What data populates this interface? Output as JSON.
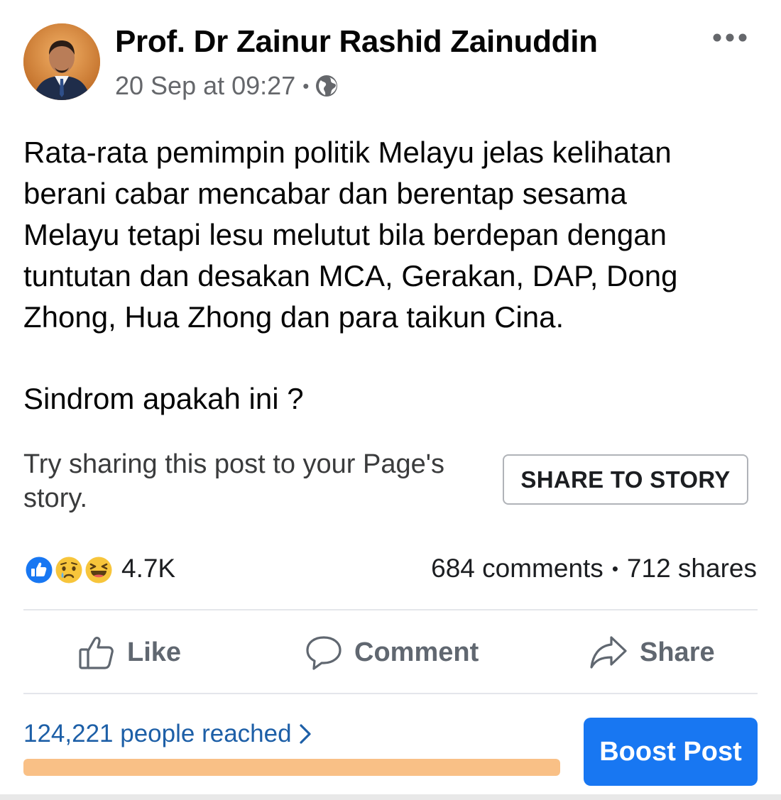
{
  "post": {
    "author": "Prof. Dr Zainur Rashid Zainuddin",
    "timestamp": "20 Sep at 09:27",
    "meta_separator": "•",
    "privacy_icon": "globe-icon",
    "more_icon": "more-dots-icon",
    "text": "Rata-rata pemimpin politik Melayu jelas kelihatan\nberani cabar mencabar dan berentap sesama\nMelayu tetapi lesu melutut bila berdepan dengan\ntuntutan dan desakan MCA, Gerakan, DAP, Dong\nZhong, Hua Zhong dan para taikun Cina.",
    "question": "Sindrom apakah ini ?"
  },
  "story": {
    "prompt": "Try sharing this post to your Page's story.",
    "button_label": "SHARE TO STORY"
  },
  "stats": {
    "reaction_icons": [
      "like-reaction-icon",
      "sad-reaction-icon",
      "haha-reaction-icon"
    ],
    "reaction_count": "4.7K",
    "comments": "684 comments",
    "separator": "•",
    "shares": "712 shares"
  },
  "actions": {
    "like_label": "Like",
    "comment_label": "Comment",
    "share_label": "Share"
  },
  "insights": {
    "reached_text": "124,221 people reached",
    "reach_progress": 1.0,
    "boost_label": "Boost Post"
  },
  "colors": {
    "accent": "#1877f2",
    "link": "#1d5fa7",
    "reach_bar": "#f9c086",
    "muted_text": "#65676b"
  }
}
